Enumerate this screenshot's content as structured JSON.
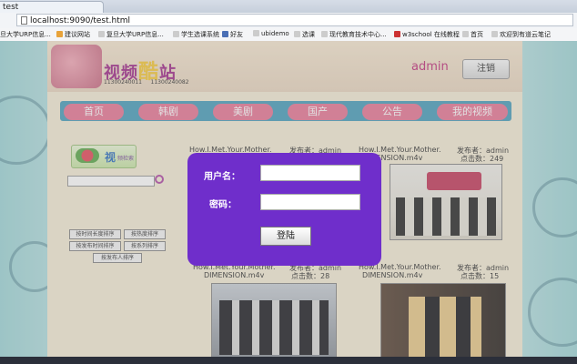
{
  "browser": {
    "tab_title": "test",
    "url": "localhost:9090/test.html",
    "bookmarks": [
      "旦大学URP信息...",
      "建议网站",
      "复旦大学URP信息...",
      "学生选课系统",
      "好友",
      "ubidemo",
      "选课",
      "现代教育技术中心...",
      "w3school 在线教程",
      "首页",
      "欢迎到有道云笔记"
    ]
  },
  "header": {
    "logo_part1": "视频",
    "logo_part2": "酷",
    "logo_part3": "站",
    "id1": "11300240011",
    "id2": "11300240082",
    "username": "admin",
    "logout_label": "注销"
  },
  "nav": {
    "items": [
      "首页",
      "韩剧",
      "美剧",
      "国产",
      "公告",
      "我的视频"
    ]
  },
  "sidebar": {
    "search_logo_text": "视",
    "search_logo_sub": "频检索",
    "sort_buttons": [
      "按时间长度排序",
      "按热度排序",
      "按发布时间排序",
      "按系列排序",
      "按发布人排序"
    ]
  },
  "videos": [
    {
      "title": "How.I.Met.Your.Mother.",
      "publisher": "发布者：admin",
      "clicks": ""
    },
    {
      "title": "How.I.Met.Your.Mother.",
      "title2": "DIMENSION.m4v",
      "publisher": "发布者：admin",
      "clicks": "点击数：249"
    },
    {
      "title": "How.I.Met.Your.Mother.",
      "title2": "DIMENSION.m4v",
      "publisher": "发布者：admin",
      "clicks": "点击数：28"
    },
    {
      "title": "How.I.Met.Your.Mother.",
      "title2": "DIMENSION.m4v",
      "publisher": "发布者：admin",
      "clicks": "点击数：15"
    }
  ],
  "login": {
    "username_label": "用户名：",
    "password_label": "密码：",
    "submit_label": "登陆"
  },
  "colors": {
    "modal_bg": "#6f2ecb",
    "nav_pill": "#e87896",
    "nav_bar": "#4a9fbc",
    "accent_admin": "#c0317c"
  }
}
